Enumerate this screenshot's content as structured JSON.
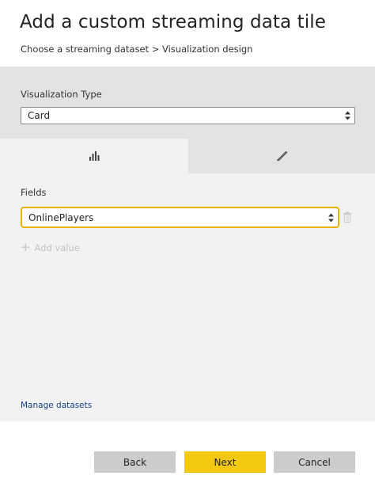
{
  "dialog": {
    "title": "Add a custom streaming data tile",
    "breadcrumb": "Choose a streaming dataset > Visualization design"
  },
  "visualization": {
    "label": "Visualization Type",
    "selected": "Card"
  },
  "tabs": [
    {
      "name": "fields",
      "icon": "bar-chart-icon",
      "active": true
    },
    {
      "name": "format",
      "icon": "paintbrush-icon",
      "active": false
    }
  ],
  "fields": {
    "label": "Fields",
    "selected": "OnlinePlayers",
    "add_value_label": "Add value",
    "delete_icon": "trash-icon"
  },
  "manage_datasets_link": "Manage datasets",
  "buttons": {
    "back": "Back",
    "next": "Next",
    "cancel": "Cancel"
  },
  "colors": {
    "accent_yellow": "#f2c811",
    "focus_border": "#e8b300",
    "link_blue": "#1a3f8c",
    "section_gray": "#e3e3e3",
    "panel_gray": "#f2f2f2",
    "button_gray": "#cccccc"
  }
}
